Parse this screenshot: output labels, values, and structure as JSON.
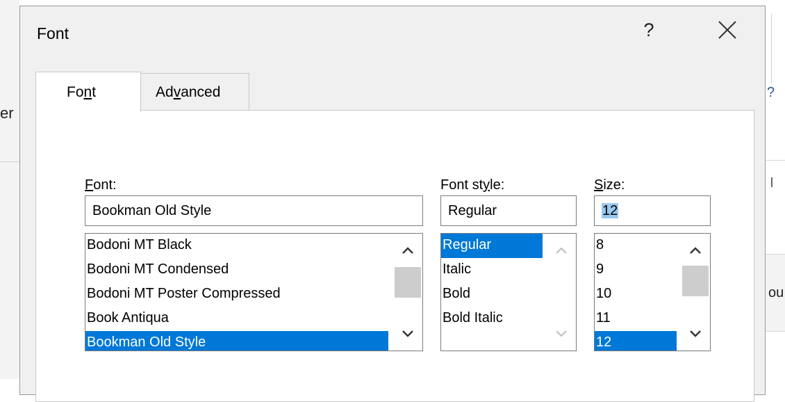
{
  "background": {
    "left_text": "er",
    "right_text": "ou"
  },
  "dialog": {
    "title": "Font",
    "help_label": "?",
    "tabs": [
      {
        "label_pre": "Fo",
        "mnemonic": "n",
        "label_post": "t"
      },
      {
        "label_pre": "Ad",
        "mnemonic": "v",
        "label_post": "anced"
      }
    ],
    "font": {
      "label_mnemonic": "F",
      "label_rest": "ont:",
      "value": "Bookman Old Style",
      "items": [
        "Bodoni MT Black",
        "Bodoni MT Condensed",
        "Bodoni MT Poster Compressed",
        "Book Antiqua",
        "Bookman Old Style"
      ],
      "selected": "Bookman Old Style"
    },
    "style": {
      "label_pre": "Font st",
      "label_mnemonic": "y",
      "label_post": "le:",
      "value": "Regular",
      "items": [
        "Regular",
        "Italic",
        "Bold",
        "Bold Italic"
      ],
      "selected": "Regular"
    },
    "size": {
      "label_mnemonic": "S",
      "label_rest": "ize:",
      "value": "12",
      "items": [
        "8",
        "9",
        "10",
        "11",
        "12"
      ],
      "selected": "12"
    }
  },
  "colors": {
    "selection": "#0078d7",
    "text_highlight": "#99c9ef",
    "dialog_bg": "#f0f0f0"
  }
}
